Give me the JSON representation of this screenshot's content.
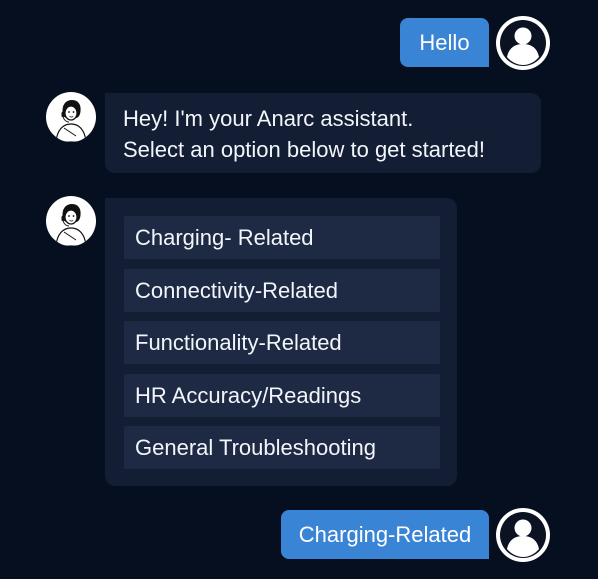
{
  "messages": {
    "user_greeting": "Hello",
    "bot_intro": {
      "line1": "Hey! I'm your Anarc assistant.",
      "line2": "Select an option below to get started!"
    },
    "options": [
      "Charging- Related",
      "Connectivity-Related",
      "Functionality-Related",
      "HR Accuracy/Readings",
      "General Troubleshooting"
    ],
    "user_selection": "Charging-Related"
  },
  "icons": {
    "user_avatar": "user-silhouette-icon",
    "bot_avatar": "assistant-illustration-icon"
  },
  "colors": {
    "background": "#060f1f",
    "user_bubble": "#3a84d6",
    "bot_bubble": "#131d33",
    "option_bg": "#1e2a44"
  }
}
